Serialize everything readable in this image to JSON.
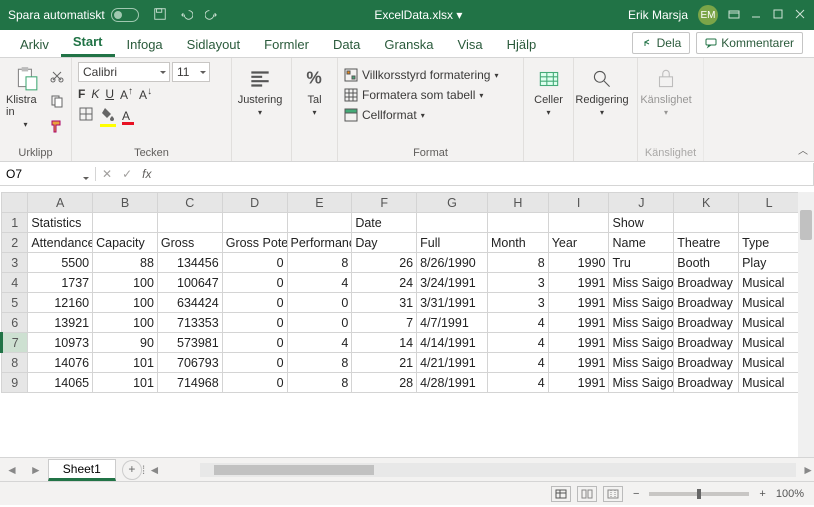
{
  "titlebar": {
    "autosave_label": "Spara automatiskt",
    "filename": "ExcelData.xlsx  ▾",
    "search_icon": "search",
    "username": "Erik Marsja",
    "avatar_initials": "EM"
  },
  "tabs": {
    "items": [
      "Arkiv",
      "Start",
      "Infoga",
      "Sidlayout",
      "Formler",
      "Data",
      "Granska",
      "Visa",
      "Hjälp"
    ],
    "active": "Start",
    "share": "Dela",
    "comments": "Kommentarer"
  },
  "ribbon": {
    "clipboard": {
      "label": "Urklipp",
      "paste": "Klistra in"
    },
    "font": {
      "label": "Tecken",
      "name": "Calibri",
      "size": "11"
    },
    "align": {
      "label": "Justering",
      "btn": "Justering"
    },
    "number": {
      "label": "Tal",
      "btn": "Tal"
    },
    "styles": {
      "label": "Format",
      "cond": "Villkorsstyrd formatering",
      "table": "Formatera som tabell",
      "cell": "Cellformat"
    },
    "cells": {
      "label": "Celler",
      "btn": "Celler"
    },
    "editing": {
      "label": "Redigering",
      "btn": "Redigering"
    },
    "sens": {
      "label": "Känslighet",
      "btn": "Känslighet"
    }
  },
  "namebox": {
    "ref": "O7",
    "formula": ""
  },
  "sheet": {
    "cols": [
      "A",
      "B",
      "C",
      "D",
      "E",
      "F",
      "G",
      "H",
      "I",
      "J",
      "K",
      "L"
    ],
    "header1": [
      "Statistics",
      "",
      "",
      "",
      "",
      "Date",
      "",
      "",
      "",
      "Show",
      "",
      ""
    ],
    "header2": [
      "Attendance",
      "Capacity",
      "Gross",
      "Gross Potential",
      "Performances",
      "Day",
      "Full",
      "Month",
      "Year",
      "Name",
      "Theatre",
      "Type"
    ],
    "rows": [
      {
        "n": 3,
        "cells": [
          "5500",
          "88",
          "134456",
          "0",
          "8",
          "26",
          "8/26/1990",
          "8",
          "1990",
          "Tru",
          "Booth",
          "Play"
        ]
      },
      {
        "n": 4,
        "cells": [
          "1737",
          "100",
          "100647",
          "0",
          "4",
          "24",
          "3/24/1991",
          "3",
          "1991",
          "Miss Saigon",
          "Broadway",
          "Musical"
        ]
      },
      {
        "n": 5,
        "cells": [
          "12160",
          "100",
          "634424",
          "0",
          "0",
          "31",
          "3/31/1991",
          "3",
          "1991",
          "Miss Saigon",
          "Broadway",
          "Musical"
        ]
      },
      {
        "n": 6,
        "cells": [
          "13921",
          "100",
          "713353",
          "0",
          "0",
          "7",
          "4/7/1991",
          "4",
          "1991",
          "Miss Saigon",
          "Broadway",
          "Musical"
        ]
      },
      {
        "n": 7,
        "cells": [
          "10973",
          "90",
          "573981",
          "0",
          "4",
          "14",
          "4/14/1991",
          "4",
          "1991",
          "Miss Saigon",
          "Broadway",
          "Musical"
        ]
      },
      {
        "n": 8,
        "cells": [
          "14076",
          "101",
          "706793",
          "0",
          "8",
          "21",
          "4/21/1991",
          "4",
          "1991",
          "Miss Saigon",
          "Broadway",
          "Musical"
        ]
      },
      {
        "n": 9,
        "cells": [
          "14065",
          "101",
          "714968",
          "0",
          "8",
          "28",
          "4/28/1991",
          "4",
          "1991",
          "Miss Saigon",
          "Broadway",
          "Musical"
        ]
      }
    ],
    "tab_name": "Sheet1",
    "selected_row": 7
  },
  "statusbar": {
    "zoom": "100%"
  }
}
